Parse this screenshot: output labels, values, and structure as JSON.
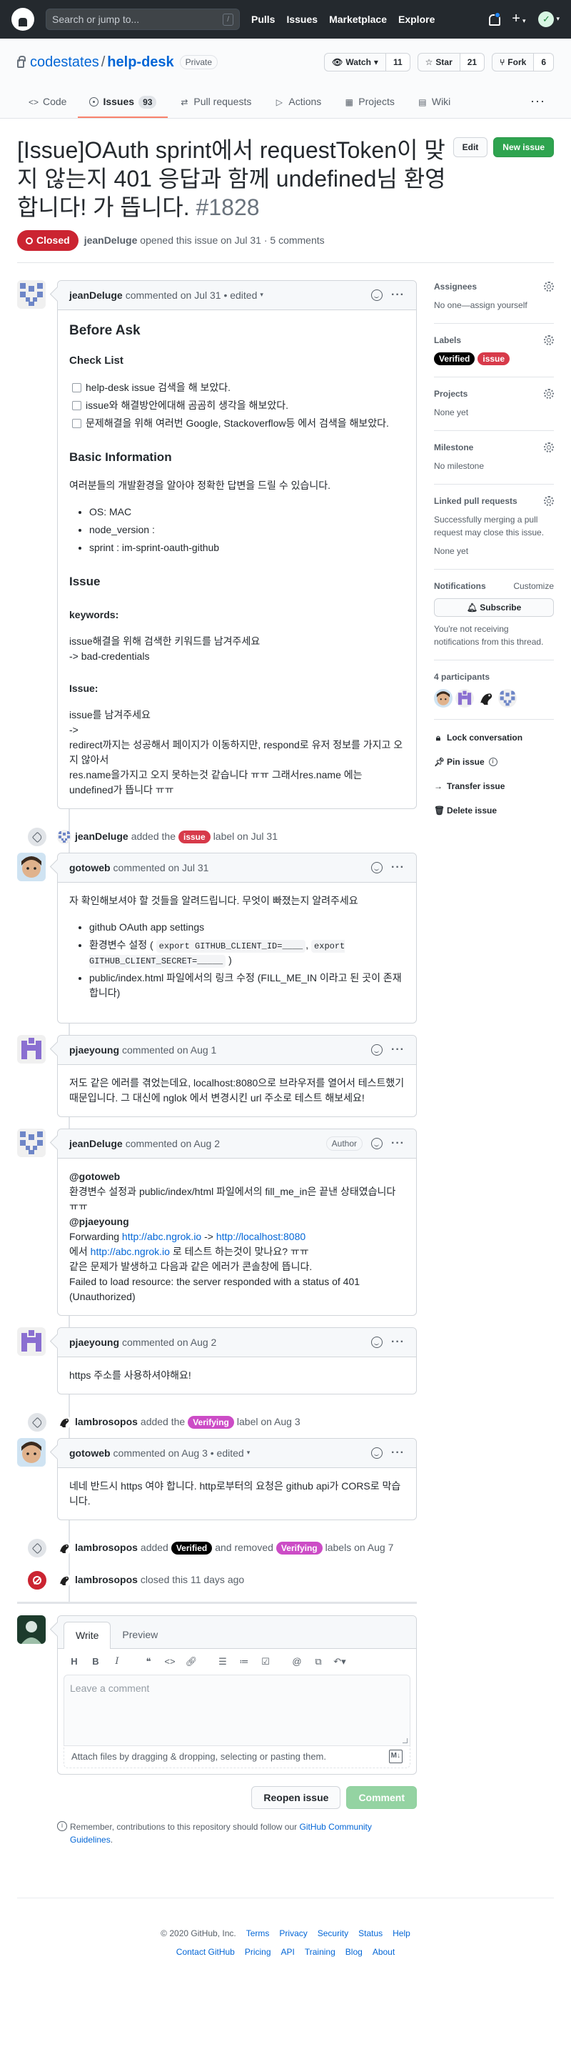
{
  "header": {
    "search_placeholder": "Search or jump to...",
    "slash_key": "/",
    "nav": [
      "Pulls",
      "Issues",
      "Marketplace",
      "Explore"
    ]
  },
  "repo": {
    "owner": "codestates",
    "name": "help-desk",
    "visibility": "Private",
    "watch_label": "Watch",
    "watch_count": "11",
    "star_label": "Star",
    "star_count": "21",
    "fork_label": "Fork",
    "fork_count": "6",
    "tabs": [
      {
        "label": "Code",
        "icon": "code-icon"
      },
      {
        "label": "Issues",
        "icon": "issue-icon",
        "count": "93"
      },
      {
        "label": "Pull requests",
        "icon": "pr-icon"
      },
      {
        "label": "Actions",
        "icon": "play-icon"
      },
      {
        "label": "Projects",
        "icon": "project-icon"
      },
      {
        "label": "Wiki",
        "icon": "book-icon"
      }
    ]
  },
  "issue": {
    "title": "[Issue]OAuth sprint에서 requestToken이 맞지 않는지 401 응답과 함께 undefined님 환영합니다! 가 뜹니다.",
    "number": "#1828",
    "edit_label": "Edit",
    "new_issue_label": "New issue",
    "status": "Closed",
    "opener": "jeanDeluge",
    "opened_text": "opened this issue on Jul 31 · 5 comments"
  },
  "first_comment": {
    "author": "jeanDeluge",
    "meta": "commented on Jul 31 • edited",
    "h_before": "Before Ask",
    "h_checklist": "Check List",
    "checks": [
      "help-desk issue 검색을 해 보았다.",
      "issue와 해결방안에대해 곰곰히 생각을 해보았다.",
      "문제해결을 위해 여러번 Google, Stackoverflow등 에서 검색을 해보았다."
    ],
    "h_basic": "Basic Information",
    "basic_intro": "여러분들의 개발환경을 알아야 정확한 답변을 드릴 수 있습니다.",
    "basic_items": [
      "OS: MAC",
      "node_version :",
      "sprint : im-sprint-oauth-github"
    ],
    "h_issue": "Issue",
    "h_keywords": "keywords:",
    "kw_line1": "issue해결을 위해 검색한 키워드를 남겨주세요",
    "kw_line2": "-> bad-credentials",
    "h_issue2": "Issue:",
    "issue_line1": "issue를 남겨주세요",
    "issue_line2": "->",
    "issue_line3": "redirect까지는 성공해서 페이지가 이동하지만, respond로 유저 정보를 가지고 오지 않아서",
    "issue_line4": "res.name을가지고 오지 못하는것 같습니다 ㅠㅠ 그래서res.name 에는 undefined가 뜹니다 ㅠㅠ"
  },
  "events": {
    "e1_user": "jeanDeluge",
    "e1_pre": "added the",
    "e1_label": "issue",
    "e1_post": "label on Jul 31",
    "e2_user": "lambrosopos",
    "e2_pre": "added the",
    "e2_label": "Verifying",
    "e2_post": "label on Aug 3",
    "e3_user": "lambrosopos",
    "e3_pre": "added",
    "e3_label_a": "Verified",
    "e3_mid": "and removed",
    "e3_label_b": "Verifying",
    "e3_post": "labels on Aug 7",
    "e4_user": "lambrosopos",
    "e4_text": "closed this 11 days ago"
  },
  "comments": {
    "c2_author": "gotoweb",
    "c2_meta": "commented on Jul 31",
    "c2_intro": "자 확인해보셔야 할 것들을 알려드립니다. 무엇이 빠졌는지 알려주세요",
    "c2_li1": "github OAuth app settings",
    "c2_li2_pre": "환경변수 설정 (",
    "c2_li2_code1": "export GITHUB_CLIENT_ID=____",
    "c2_li2_comma": ",",
    "c2_li2_code2": "export GITHUB_CLIENT_SECRET=_____",
    "c2_li2_post": ")",
    "c2_li3": "public/index.html 파일에서의 링크 수정 (FILL_ME_IN 이라고 된 곳이 존재합니다)",
    "c3_author": "pjaeyoung",
    "c3_meta": "commented on Aug 1",
    "c3_body": "저도 같은 에러를 겪었는데요, localhost:8080으로 브라우저를 열어서 테스트했기 때문입니다. 그 대신에 nglok 에서 변경시킨 url 주소로 테스트 해보세요!",
    "c4_author": "jeanDeluge",
    "c4_meta": "commented on Aug 2",
    "c4_badge": "Author",
    "c4_l1a": "@gotoweb",
    "c4_l2": "환경변수 설정과 public/index/html 파일에서의 fill_me_in은 끝낸 상태였습니다 ㅠㅠ",
    "c4_l3a": "@pjaeyoung",
    "c4_l4_pre": "Forwarding ",
    "c4_l4_link1": "http://abc.ngrok.io",
    "c4_l4_mid": " -> ",
    "c4_l4_link2": "http://localhost:8080",
    "c4_l5_pre": "에서 ",
    "c4_l5_link": "http://abc.ngrok.io",
    "c4_l5_post": " 로 테스트 하는것이 맞나요? ㅠㅠ",
    "c4_l6": "같은 문제가 발생하고 다음과 같은 에러가 콘솔창에 뜹니다.",
    "c4_l7": "Failed to load resource: the server responded with a status of 401 (Unauthorized)",
    "c5_author": "pjaeyoung",
    "c5_meta": "commented on Aug 2",
    "c5_body": "https 주소를 사용하셔야해요!",
    "c6_author": "gotoweb",
    "c6_meta": "commented on Aug 3 • edited",
    "c6_body": "네네 반드시 https 여야 합니다. http로부터의 요청은 github api가 CORS로 막습니다."
  },
  "new_comment": {
    "tab_write": "Write",
    "tab_preview": "Preview",
    "placeholder": "Leave a comment",
    "attach": "Attach files by dragging & dropping, selecting or pasting them.",
    "reopen_label": "Reopen issue",
    "comment_label": "Comment",
    "note_pre": "Remember, contributions to this repository should follow our ",
    "note_link": "GitHub Community Guidelines",
    "note_post": "."
  },
  "sidebar": {
    "assignees_title": "Assignees",
    "assignees_value": "No one—assign yourself",
    "labels_title": "Labels",
    "label1": "Verified",
    "label2": "issue",
    "projects_title": "Projects",
    "projects_value": "None yet",
    "milestone_title": "Milestone",
    "milestone_value": "No milestone",
    "linked_title": "Linked pull requests",
    "linked_desc": "Successfully merging a pull request may close this issue.",
    "linked_value": "None yet",
    "notif_title": "Notifications",
    "notif_customize": "Customize",
    "subscribe_label": "Subscribe",
    "notif_desc": "You're not receiving notifications from this thread.",
    "participants_title": "4 participants",
    "lock_label": "Lock conversation",
    "pin_label": "Pin issue",
    "transfer_label": "Transfer issue",
    "delete_label": "Delete issue"
  },
  "footer": {
    "copyright": "© 2020 GitHub, Inc.",
    "row1": [
      "Terms",
      "Privacy",
      "Security",
      "Status",
      "Help"
    ],
    "row2": [
      "Contact GitHub",
      "Pricing",
      "API",
      "Training",
      "Blog",
      "About"
    ]
  },
  "colors": {
    "label_issue": "#d73a4a",
    "label_verifying": "#cc4cc6",
    "label_verified": "#000000",
    "closed_badge": "#cb2431",
    "new_issue_green": "#2ea44f"
  }
}
